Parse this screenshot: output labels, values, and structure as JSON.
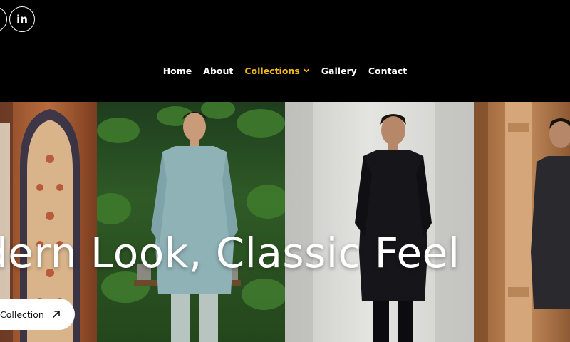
{
  "social": {
    "items": [
      {
        "name": "partial-social",
        "glyph": ""
      },
      {
        "name": "linkedin",
        "glyph": "in"
      }
    ]
  },
  "nav": {
    "items": [
      {
        "label": "Home"
      },
      {
        "label": "About"
      },
      {
        "label": "Collections",
        "active": true,
        "has_dropdown": true
      },
      {
        "label": "Gallery"
      },
      {
        "label": "Contact"
      }
    ]
  },
  "hero": {
    "title": "odern Look, Classic Feel",
    "cta_label": "Collection",
    "cta_icon": "arrow-up-right-icon"
  },
  "colors": {
    "accent": "#f2b91a",
    "divider": "#b8932a",
    "background": "#000000"
  }
}
